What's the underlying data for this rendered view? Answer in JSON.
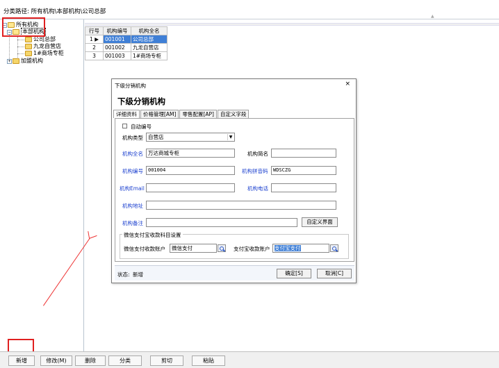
{
  "path_bar": {
    "label": "分类路径:",
    "value": "所有机构\\本部机构\\公司总部"
  },
  "tree": {
    "root": "所有机构",
    "hq": "本部机构",
    "hq_children": [
      "公司总部",
      "九龙自营店",
      "1#商场专柜"
    ],
    "franchise": "加盟机构",
    "expand_minus": "−",
    "expand_plus": "+"
  },
  "grid": {
    "headers": [
      "行号",
      "机构编号",
      "机构全名"
    ],
    "rows": [
      {
        "no": "1",
        "code": "001001",
        "name": "公司总部"
      },
      {
        "no": "2",
        "code": "001002",
        "name": "九龙自营店"
      },
      {
        "no": "3",
        "code": "001003",
        "name": "1#商场专柜"
      }
    ],
    "row_pointer": "▶"
  },
  "dialog": {
    "title": "下级分销机构",
    "heading": "下级分销机构",
    "close": "×",
    "tabs": [
      "详细资料",
      "价格管理[AM]",
      "零售配置[AP]",
      "自定义字段"
    ],
    "auto_number_label": "自动编号",
    "type_label": "机构类型",
    "type_value": "自营店",
    "full_name_label": "机构全名",
    "full_name_value": "万达商城专柜",
    "short_name_label": "机构简名",
    "short_name_value": "",
    "code_label": "机构编号",
    "code_value": "001004",
    "pinyin_label": "机构拼音码",
    "pinyin_value": "WDSCZG",
    "email_label": "机构Email",
    "email_value": "",
    "phone_label": "机构电话",
    "phone_value": "",
    "address_label": "机构地址",
    "address_value": "",
    "remark_label": "机构备注",
    "remark_value": "",
    "custom_ui_button": "自定义界面",
    "group_title": "微信支付宝收款科目设置",
    "wechat_label": "微信支付收款账户",
    "wechat_value": "微信支付",
    "alipay_label": "支付宝收款账户",
    "alipay_value": "支付宝支付",
    "status_label": "状态:",
    "status_value": "新增",
    "ok_button": "确定[S]",
    "cancel_button": "取消[C]"
  },
  "toolbar": {
    "new": "新增",
    "modify": "修改(M)",
    "delete": "删除",
    "classify": "分类",
    "cut": "剪切",
    "paste": "粘贴"
  },
  "colors": {
    "accent_blue": "#3f7fd6",
    "label_blue": "#1a3fcf",
    "annotation_red": "#e02020"
  }
}
